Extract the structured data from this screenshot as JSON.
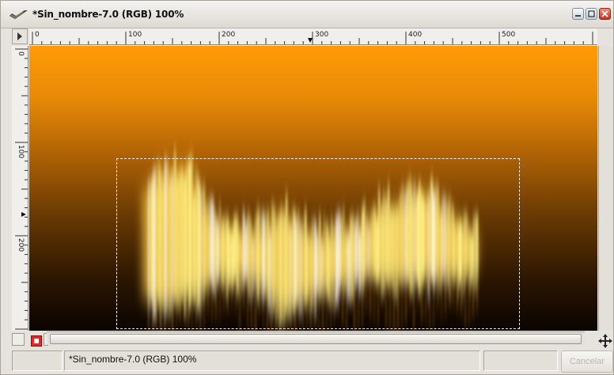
{
  "window": {
    "title": "*Sin_nombre-7.0 (RGB) 100%",
    "app_icon": "gimp-wilber-icon",
    "buttons": [
      "minimize-icon",
      "maximize-icon",
      "close-icon"
    ]
  },
  "rulers": {
    "horizontal_labels": [
      "0",
      "100",
      "200",
      "300",
      "400",
      "500"
    ],
    "vertical_labels": [
      "0",
      "100",
      "200"
    ]
  },
  "canvas": {
    "background_top_color": "#ff9b05",
    "background_bottom_color": "#0a0400",
    "fire_text_color": "#fff28a",
    "has_selection": true
  },
  "status": {
    "image_info": "*Sin_nombre-7.0 (RGB) 100%",
    "cancel_label": "Cancelar"
  },
  "icons": {
    "quick_mask": "quick-mask-icon",
    "navigate": "navigate-icon"
  }
}
